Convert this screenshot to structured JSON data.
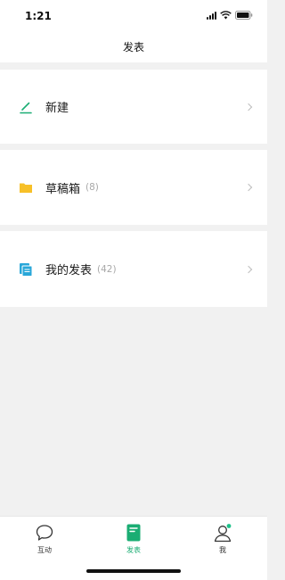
{
  "status_bar": {
    "time": "1:21"
  },
  "nav": {
    "title": "发表"
  },
  "rows": [
    {
      "label": "新建",
      "count": ""
    },
    {
      "label": "草稿箱",
      "count": "(8)"
    },
    {
      "label": "我的发表",
      "count": "(42)"
    }
  ],
  "tabs": [
    {
      "label": "互动",
      "active": false
    },
    {
      "label": "发表",
      "active": true
    },
    {
      "label": "我",
      "active": false,
      "badge": true
    }
  ],
  "colors": {
    "accent": "#1aad73",
    "folder": "#f7c028",
    "doc_blue": "#29a7d9",
    "badge": "#1dc18a"
  }
}
